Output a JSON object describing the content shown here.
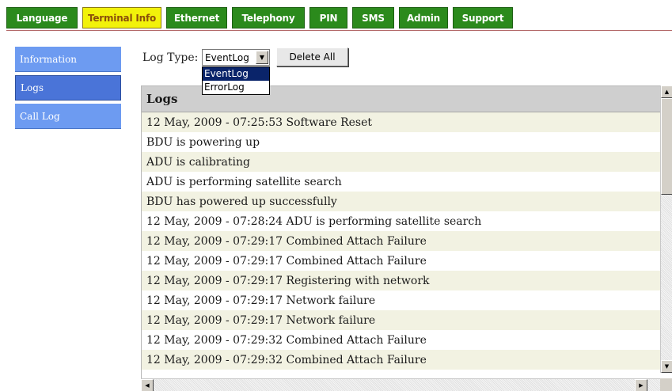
{
  "topnav": {
    "tabs": [
      {
        "label": "Language"
      },
      {
        "label": "Terminal Info"
      },
      {
        "label": "Ethernet"
      },
      {
        "label": "Telephony"
      },
      {
        "label": "PIN"
      },
      {
        "label": "SMS"
      },
      {
        "label": "Admin"
      },
      {
        "label": "Support"
      }
    ],
    "active": "Terminal Info"
  },
  "sidebar": {
    "items": [
      {
        "label": "Information"
      },
      {
        "label": "Logs"
      },
      {
        "label": "Call Log"
      }
    ],
    "active": "Logs"
  },
  "log_type": {
    "label": "Log Type:",
    "selected": "EventLog",
    "options": [
      "EventLog",
      "ErrorLog"
    ],
    "dropdown_open": true
  },
  "delete_button": {
    "label": "Delete All"
  },
  "logs": {
    "header": "Logs",
    "rows": [
      "12 May, 2009 - 07:25:53 Software Reset",
      "BDU is powering up",
      "ADU is calibrating",
      "ADU is performing satellite search",
      "BDU has powered up successfully",
      "12 May, 2009 - 07:28:24 ADU is performing satellite search",
      "12 May, 2009 - 07:29:17 Combined Attach Failure",
      "12 May, 2009 - 07:29:17 Combined Attach Failure",
      "12 May, 2009 - 07:29:17 Registering with network",
      "12 May, 2009 - 07:29:17 Network failure",
      "12 May, 2009 - 07:29:17 Network failure",
      "12 May, 2009 - 07:29:32 Combined Attach Failure",
      "12 May, 2009 - 07:29:32 Combined Attach Failure"
    ]
  },
  "colors": {
    "tab_green": "#2b8a1c",
    "tab_active_yellow": "#f2f20a",
    "menu_blue": "#6d9bf1",
    "menu_active_blue": "#4a74d8",
    "row_alt": "#f2f2e2",
    "header_gray": "#cfcfcf"
  },
  "icons": {
    "select_arrow": "chevron-down-icon",
    "scroll_up": "arrow-up-icon",
    "scroll_down": "arrow-down-icon",
    "scroll_left": "arrow-left-icon",
    "scroll_right": "arrow-right-icon"
  }
}
